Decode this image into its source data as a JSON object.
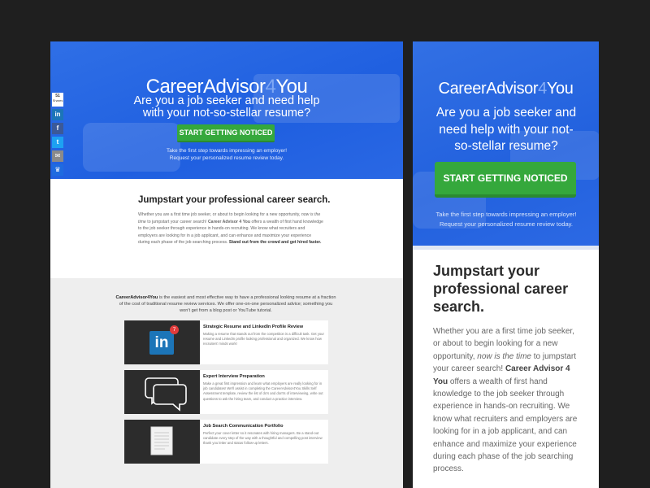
{
  "desktop": {
    "hero": {
      "brand_main": "CareerAdvisor",
      "brand_num": "4",
      "brand_end": "You",
      "tagline": "Are you a job seeker and need help with your not-so-stellar resume?",
      "cta": "START GETTING NOTICED",
      "sub_line1": "Take the first step towards impressing an employer!",
      "sub_line2": "Request your personalized resume review today."
    },
    "share": {
      "count": "51",
      "count_label": "Shares",
      "linkedin": "in",
      "facebook": "f",
      "twitter": "t",
      "email": "✉",
      "more": "♛"
    },
    "intro": {
      "heading": "Jumpstart your professional career search.",
      "p_a": "Whether you are a first time job seeker, or about to begin looking for a new opportunity, ",
      "p_em": "now is the time",
      "p_b": " to jumpstart your career search! ",
      "p_strong": "Career Advisor 4 You",
      "p_c": " offers a wealth of first hand knowledge to the job seeker through experience in hands-on recruiting. We know what recruiters and employers are looking for in a job applicant, and can enhance and maximize your experience during each phase of the job searching process. ",
      "p_strong2": "Stand out from the crowd and get hired faster."
    },
    "lower": {
      "lead_strong": "CareerAdvisor4You",
      "lead_rest": " is the easiest and most effective way to have a professional looking resume at a fraction of the cost of traditional resume review services. We offer one-on-one personalized advice; something you won't get from a blog post or YouTube tutorial."
    },
    "services": [
      {
        "title": "Strategic Resume and LinkedIn Profile Review",
        "desc": "Making a resume that stands out from the competition is a difficult task. Get your resume and LinkedIn profile looking professional and organized. We know how recruiters' minds work!",
        "badge": "7",
        "logo": "in"
      },
      {
        "title": "Expert Interview Preparation",
        "desc": "Make a great first impression and learn what employers are really looking for in job candidates! We'll assist in completing the CareerAdvisor4You Skills Self Assessment template, review the list of do's and don'ts of interviewing, write out questions to ask the hiring team, and conduct a practice interview."
      },
      {
        "title": "Job Search Communication Portfolio",
        "desc": "Perfect your cover letter so it resonates with hiring managers. Be a stand-out candidate every step of the way with a thoughtful and compelling post interview thank you letter and status follow-up letters."
      }
    ]
  },
  "mobile": {
    "hero": {
      "brand_main": "CareerAdvisor",
      "brand_num": "4",
      "brand_end": "You",
      "tagline": "Are you a job seeker and need help with your not-so-stellar resume?",
      "cta": "START GETTING NOTICED",
      "sub_line1": "Take the first step towards impressing an employer!",
      "sub_line2": "Request your personalized resume review today."
    },
    "body": {
      "heading": "Jumpstart your professional career search.",
      "p_a": "Whether you are a first time job seeker, or about to begin looking for a new opportunity, ",
      "p_em": "now is the time",
      "p_b": " to jumpstart your career search! ",
      "p_strong": "Career Advisor 4 You",
      "p_c": " offers a wealth of first hand knowledge to the job seeker through experience in hands-on recruiting. We know what recruiters and employers are looking for in a job applicant, and can enhance and maximize your experience during each phase of the job searching process."
    }
  },
  "colors": {
    "hero_blue": "#2565e2",
    "cta_green": "#35a83c",
    "linkedin_blue": "#1c75b8",
    "facebook": "#3b5998",
    "twitter": "#1da1f2",
    "email": "#8a8a8a",
    "more": "#1e6be0",
    "badge_red": "#e23b3b"
  }
}
